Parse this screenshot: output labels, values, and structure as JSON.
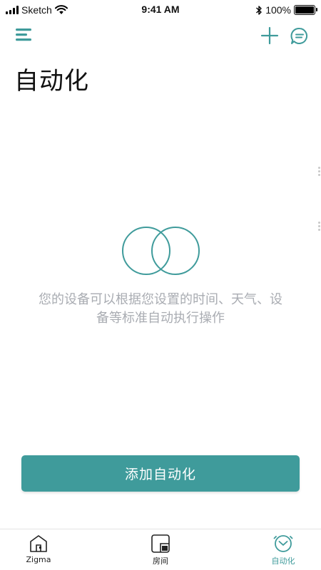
{
  "status_bar": {
    "carrier": "Sketch",
    "time": "9:41 AM",
    "battery": "100%",
    "battery_level": 1.0
  },
  "header": {
    "menu_icon": "menu-icon",
    "add_icon": "plus-icon",
    "message_icon": "message-icon",
    "title": "自动化"
  },
  "empty_state": {
    "illustration_icon": "overlapping-circles-icon",
    "line1": "您的设备可以根据您设置的时间、天气、设",
    "line2": "备等标准自动执行操作"
  },
  "primary_button": {
    "label": "添加自动化"
  },
  "tab_bar": {
    "tabs": [
      {
        "label": "Zigma",
        "icon": "home-icon",
        "active": false
      },
      {
        "label": "房间",
        "icon": "room-icon",
        "active": false
      },
      {
        "label": "自动化",
        "icon": "automation-clock-icon",
        "active": true
      }
    ]
  },
  "colors": {
    "accent": "#3f9b9b",
    "empty_text": "#a9acb2",
    "title": "#111111"
  }
}
